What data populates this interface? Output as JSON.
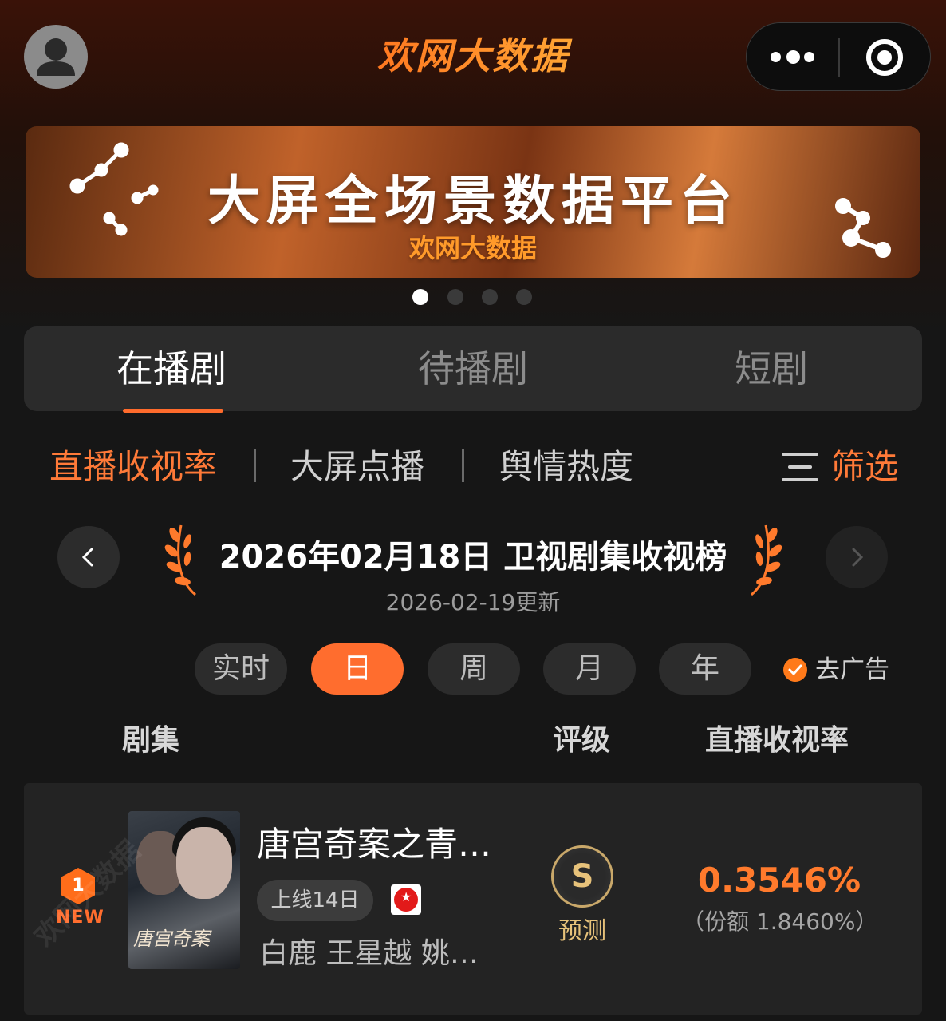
{
  "app": {
    "title": "欢网大数据"
  },
  "banner": {
    "main": "大屏全场景数据平台",
    "sub": "欢网大数据",
    "pages": 4,
    "active_page": 1
  },
  "tabs": [
    {
      "label": "在播剧",
      "active": true
    },
    {
      "label": "待播剧",
      "active": false
    },
    {
      "label": "短剧",
      "active": false
    }
  ],
  "subtabs": [
    {
      "label": "直播收视率",
      "active": true
    },
    {
      "label": "大屏点播",
      "active": false
    },
    {
      "label": "舆情热度",
      "active": false
    }
  ],
  "filter_label": "筛选",
  "chart_header": {
    "title": "2026年02月18日 卫视剧集收视榜",
    "updated": "2026-02-19更新"
  },
  "periods": [
    {
      "label": "实时",
      "active": false
    },
    {
      "label": "日",
      "active": true
    },
    {
      "label": "周",
      "active": false
    },
    {
      "label": "月",
      "active": false
    },
    {
      "label": "年",
      "active": false
    }
  ],
  "remove_ads": "去广告",
  "table": {
    "headers": {
      "show": "剧集",
      "grade": "评级",
      "rating": "直播收视率"
    },
    "rows": [
      {
        "rank": "1",
        "badge": "NEW",
        "poster_text": "唐宫奇案",
        "title": "唐宫奇案之青…",
        "days_online": "上线14日",
        "channel_icon": "dragon-tv-icon",
        "cast": "白鹿 王星越 姚…",
        "grade": "S",
        "grade_note": "预测",
        "rating": "0.3546%",
        "share": "（份额 1.8460%）"
      }
    ]
  },
  "watermark": "欢网大数据",
  "colors": {
    "accent": "#ff6d2e",
    "gold": "#e7c27a",
    "background": "#161616"
  }
}
